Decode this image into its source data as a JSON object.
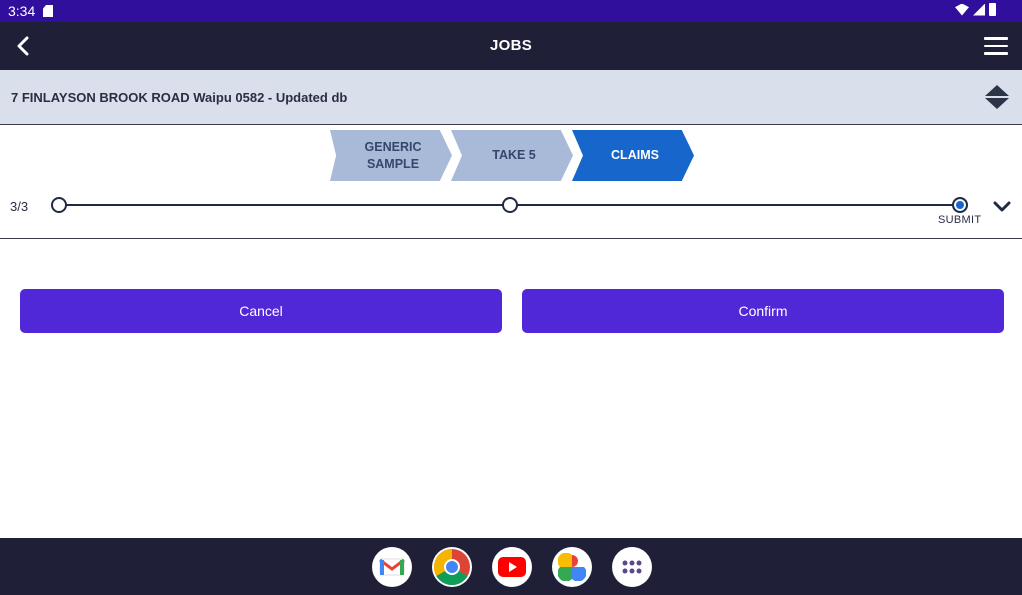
{
  "status_bar": {
    "time": "3:34",
    "icons": [
      "sd-card-icon",
      "wifi-icon",
      "signal-icon",
      "battery-icon"
    ]
  },
  "app_bar": {
    "title": "JOBS",
    "icons": [
      "back-arrow-icon",
      "hamburger-menu-icon"
    ]
  },
  "address": {
    "text": "7 FINLAYSON BROOK ROAD Waipu 0582 - Updated db",
    "icon": "sort-arrows-icon"
  },
  "steps": [
    {
      "label": "GENERIC\nSAMPLE",
      "state": "completed"
    },
    {
      "label": "TAKE 5",
      "state": "completed"
    },
    {
      "label": "CLAIMS",
      "state": "active"
    }
  ],
  "progress": {
    "count": "3/3",
    "current_step": 3,
    "total_steps": 3,
    "end_label": "SUBMIT",
    "expand_icon": "chevron-down-icon"
  },
  "actions": {
    "cancel_label": "Cancel",
    "confirm_label": "Confirm"
  },
  "dock": {
    "apps": [
      "gmail-icon",
      "chrome-icon",
      "youtube-icon",
      "photos-icon",
      "app-drawer-icon"
    ]
  },
  "colors": {
    "status_bar": "#2f0f9c",
    "app_bar": "#1f2038",
    "address_bar": "#d9e0eb",
    "step_inactive": "#a9bad8",
    "step_active": "#1766cc",
    "button": "#5128d8"
  }
}
